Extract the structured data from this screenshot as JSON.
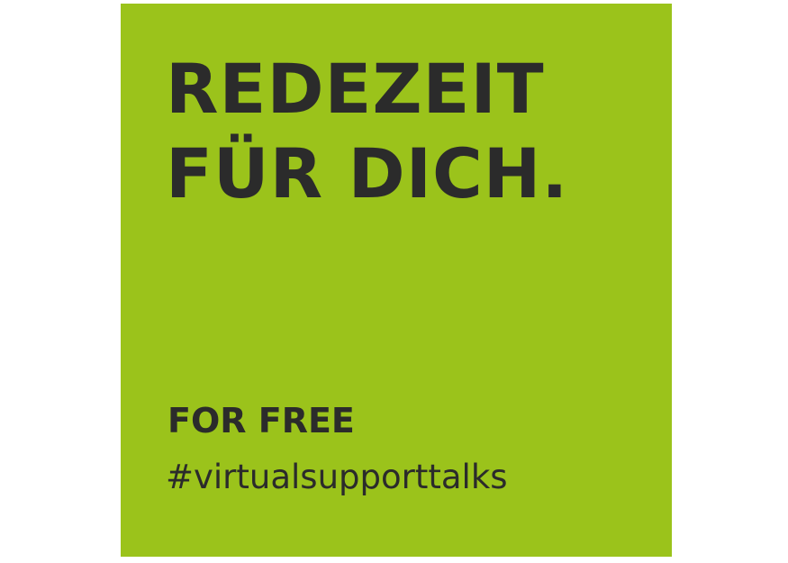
{
  "poster": {
    "headline_line1": "REDEZEIT",
    "headline_line2": "FÜR DICH.",
    "tagline": "FOR FREE",
    "hashtag": "#virtualsupporttalks"
  },
  "colors": {
    "background": "#ffffff",
    "card": "#9bc31b",
    "text": "#2b2b2b"
  }
}
